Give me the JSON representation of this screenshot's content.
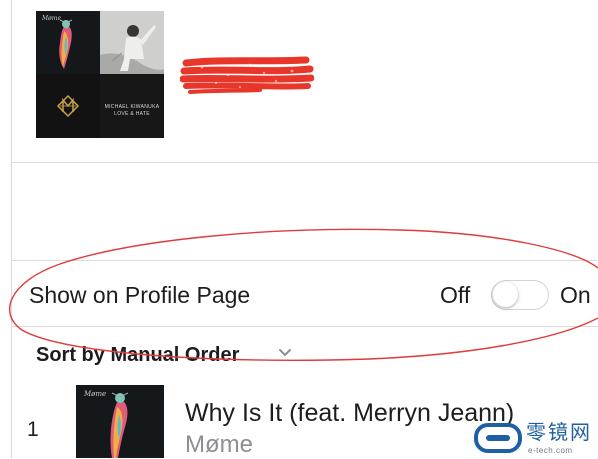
{
  "playlist": {
    "artwork_tiles": [
      {
        "name": "album-art-mome-tile",
        "caption": ""
      },
      {
        "name": "album-art-portrait-tile",
        "caption": ""
      },
      {
        "name": "album-art-monogram-tile",
        "caption": ""
      },
      {
        "name": "album-art-love-hate-tile",
        "caption": "MICHAEL KIWANUKA\nLOVE & HATE"
      }
    ],
    "redaction_color": "#e8362a"
  },
  "profile": {
    "label": "Show on Profile Page",
    "off_label": "Off",
    "on_label": "On",
    "toggle_state": "off"
  },
  "sort": {
    "label": "Sort by Manual Order"
  },
  "tracks": [
    {
      "number": "1",
      "title": "Why Is It (feat. Merryn Jeann)",
      "artist": "Møme"
    }
  ],
  "annotation": {
    "color": "#e03a3a",
    "shape": "ellipse"
  },
  "watermark": {
    "name": "零镜网",
    "url": "e-tech.com",
    "color": "#1f5fa3"
  }
}
